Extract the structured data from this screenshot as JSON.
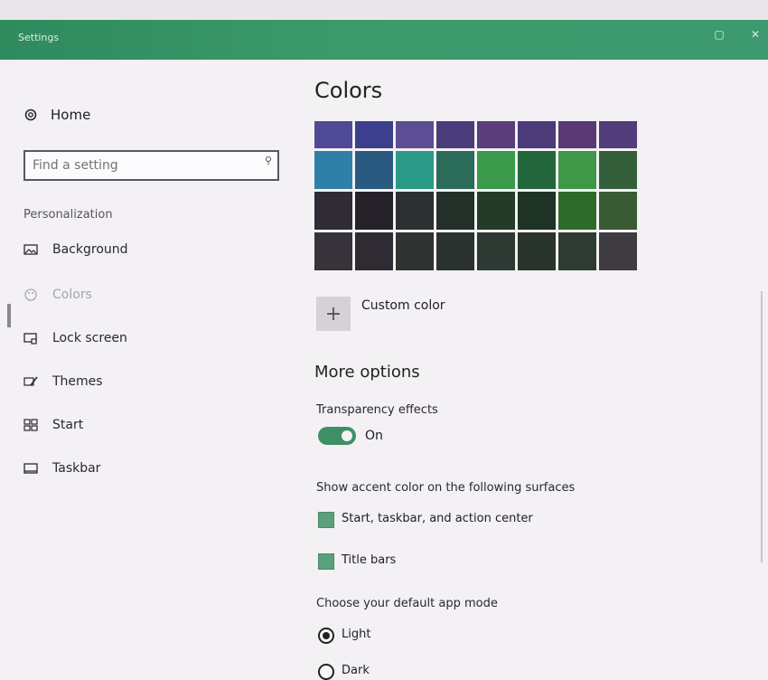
{
  "window": {
    "title": "Settings"
  },
  "sidebar": {
    "home": "Home",
    "search_placeholder": "Find a setting",
    "section": "Personalization",
    "items": [
      {
        "label": "Background",
        "icon": "picture-icon",
        "active": false
      },
      {
        "label": "Colors",
        "icon": "palette-icon",
        "active": true
      },
      {
        "label": "Lock screen",
        "icon": "lock-screen-icon",
        "active": false
      },
      {
        "label": "Themes",
        "icon": "brush-icon",
        "active": false
      },
      {
        "label": "Start",
        "icon": "start-grid-icon",
        "active": false
      },
      {
        "label": "Taskbar",
        "icon": "taskbar-icon",
        "active": false
      }
    ]
  },
  "main": {
    "title": "Colors",
    "swatches": [
      [
        "#4e4a96",
        "#3b3f8c",
        "#5b4e94",
        "#4a3c7a",
        "#5a3d7a",
        "#4b3b78",
        "#5a3a74",
        "#523c79"
      ],
      [
        "#2f7fa8",
        "#2b5a80",
        "#2a9a86",
        "#2a6b5a",
        "#3b9a4a",
        "#23663b",
        "#3e9848",
        "#355e3b"
      ],
      [
        "#2f2c36",
        "#25222a",
        "#2d3030",
        "#24302a",
        "#263a2a",
        "#1f3326",
        "#2e6b2a",
        "#3a5a34"
      ],
      [
        "#36333b",
        "#2e2c32",
        "#2f3332",
        "#2b3330",
        "#2c3a33",
        "#29342d",
        "#2e3b33",
        "#3e3c40"
      ]
    ],
    "custom_color": "Custom color",
    "more_options": "More options",
    "transparency_label": "Transparency effects",
    "transparency_state": "On",
    "accent_label": "Show accent color on the following surfaces",
    "accent_opt1": "Start, taskbar, and action center",
    "accent_opt2": "Title bars",
    "mode_label": "Choose your default app mode",
    "mode_light": "Light",
    "mode_dark": "Dark"
  },
  "colors": {
    "accent": "#3f8f66",
    "titlebar": "#3c9a6a"
  }
}
